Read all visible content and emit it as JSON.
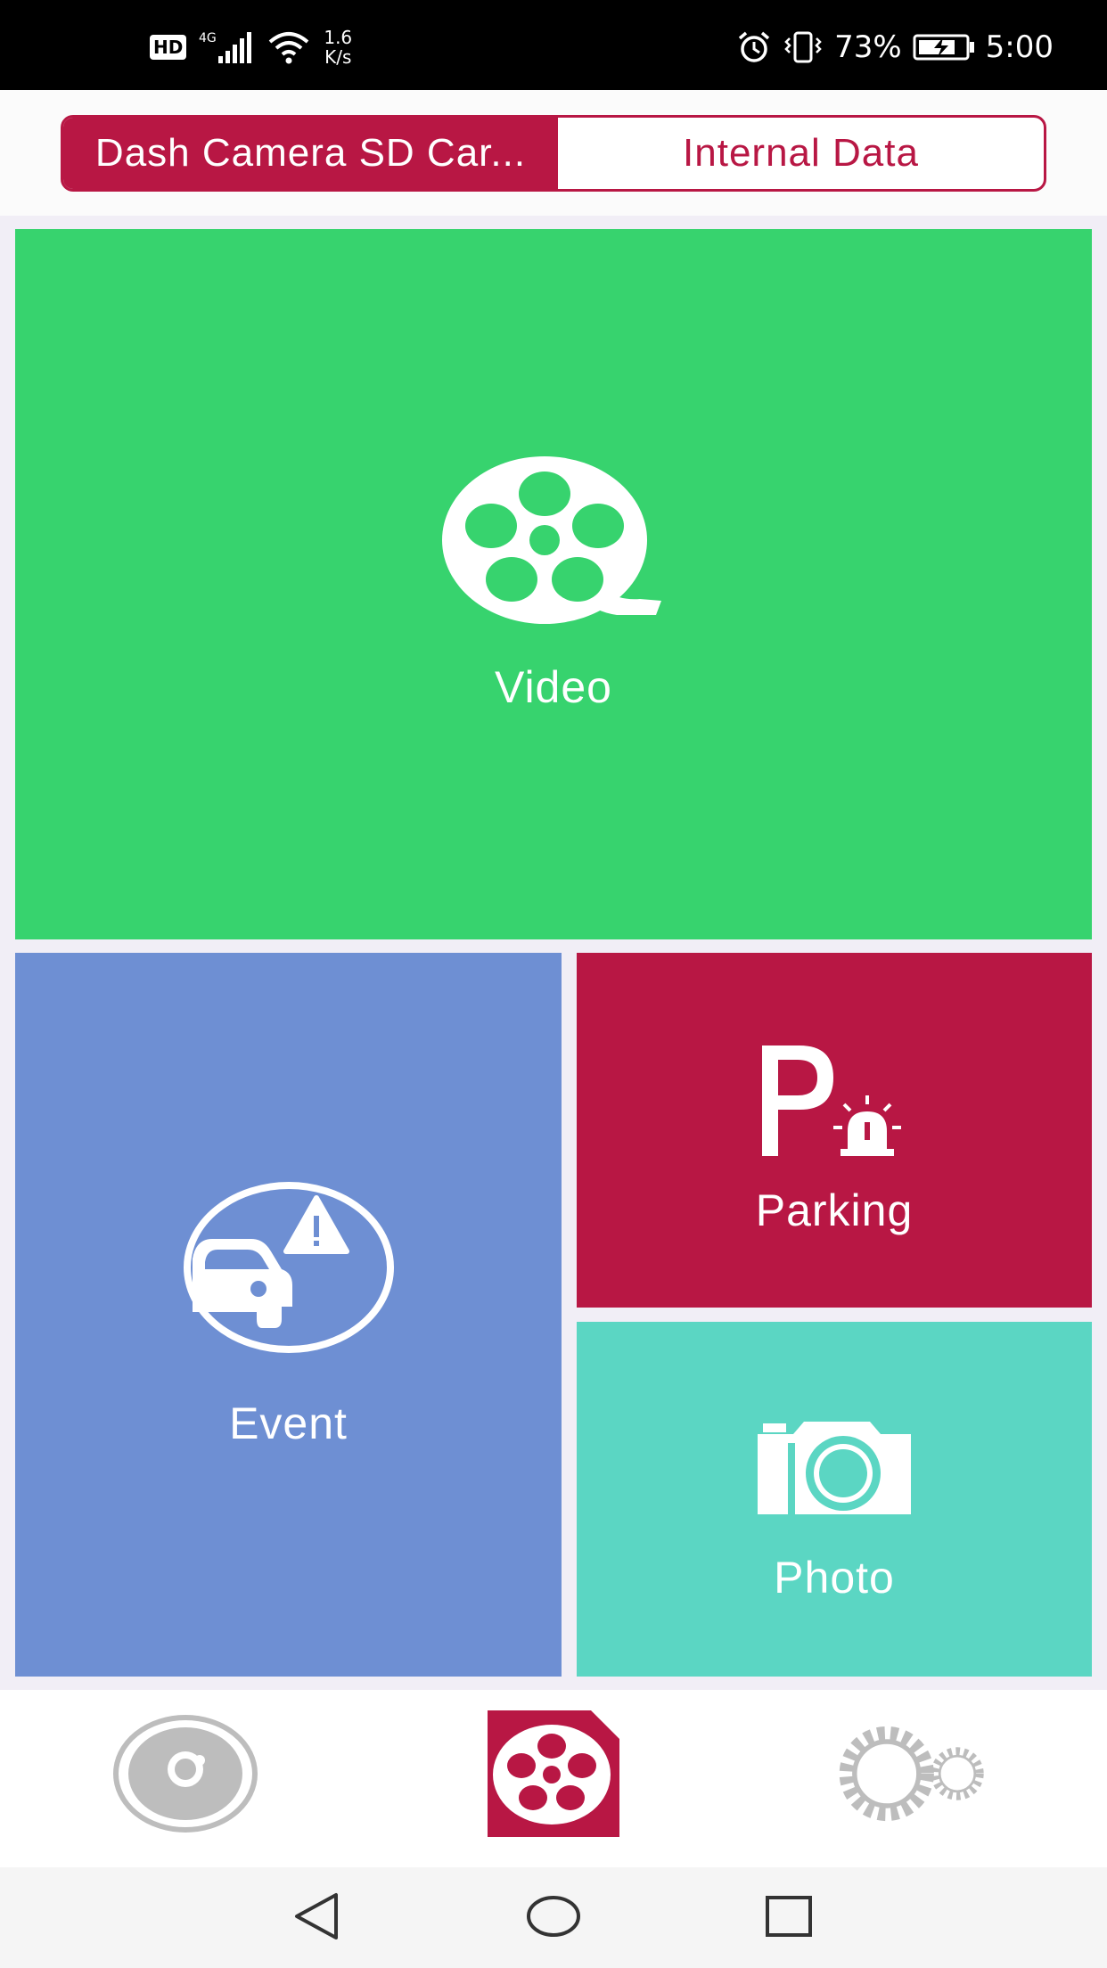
{
  "status_bar": {
    "hd": "HD",
    "network": "4G",
    "speed_value": "1.6",
    "speed_unit": "K/s",
    "battery": "73%",
    "time": "5:00",
    "icons": [
      "hd-icon",
      "signal-icon",
      "wifi-icon",
      "alarm-icon",
      "vibrate-icon",
      "battery-charging-icon"
    ]
  },
  "segment": {
    "active_label": "Dash Camera SD Car...",
    "inactive_label": "Internal Data"
  },
  "tiles": {
    "video": {
      "label": "Video",
      "icon": "film-reel-icon",
      "color": "#37d36e"
    },
    "event": {
      "label": "Event",
      "icon": "car-warning-icon",
      "color": "#6e8fd3"
    },
    "parking": {
      "label": "Parking",
      "icon": "parking-alarm-icon",
      "color": "#b81744"
    },
    "photo": {
      "label": "Photo",
      "icon": "camera-icon",
      "color": "#5bd6c3"
    }
  },
  "tabbar": {
    "tabs": [
      {
        "icon": "dash-camera-icon",
        "active": false
      },
      {
        "icon": "files-reel-icon",
        "active": true
      },
      {
        "icon": "settings-gears-icon",
        "active": false
      }
    ]
  },
  "colors": {
    "accent": "#b81744",
    "inactive_icon": "#bdbdbd"
  }
}
